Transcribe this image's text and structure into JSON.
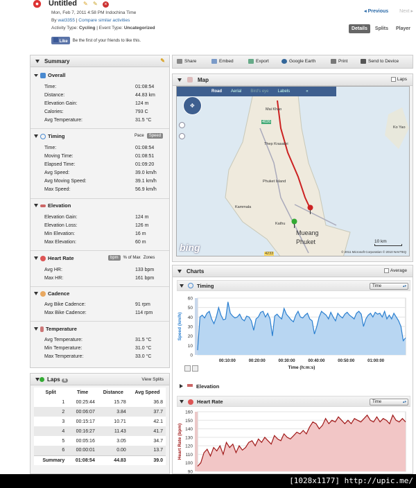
{
  "activity": {
    "title": "Untitled",
    "date_line": "Mon, Feb 7, 2011 4:58 PM Indochina Time",
    "by_prefix": "By",
    "user": "wat3355",
    "compare_link": "Compare similar activities",
    "type_label": "Activity Type:",
    "type_value": "Cycling",
    "event_label": "Event Type:",
    "event_value": "Uncategorized"
  },
  "nav": {
    "prev": "◂ Previous",
    "next": "Next ▸",
    "tabs": [
      "Details",
      "Splits",
      "Player"
    ]
  },
  "facebook": {
    "like": "Like",
    "text": "Be the first of your friends to like this."
  },
  "summary": {
    "title": "Summary",
    "overall": {
      "title": "Overall",
      "rows": [
        [
          "Time:",
          "01:08:54"
        ],
        [
          "Distance:",
          "44.83 km"
        ],
        [
          "Elevation Gain:",
          "124 m"
        ],
        [
          "Calories:",
          "793 C"
        ],
        [
          "Avg Temperature:",
          "31.5 °C"
        ]
      ]
    },
    "timing": {
      "title": "Timing",
      "toggle": [
        "Pace",
        "Speed"
      ],
      "rows": [
        [
          "Time:",
          "01:08:54"
        ],
        [
          "Moving Time:",
          "01:08:51"
        ],
        [
          "Elapsed Time:",
          "01:09:20"
        ],
        [
          "Avg Speed:",
          "39.0 km/h"
        ],
        [
          "Avg Moving Speed:",
          "39.1 km/h"
        ],
        [
          "Max Speed:",
          "56.9 km/h"
        ]
      ]
    },
    "elevation": {
      "title": "Elevation",
      "rows": [
        [
          "Elevation Gain:",
          "124 m"
        ],
        [
          "Elevation Loss:",
          "126 m"
        ],
        [
          "Min Elevation:",
          "16 m"
        ],
        [
          "Max Elevation:",
          "60 m"
        ]
      ]
    },
    "heart_rate": {
      "title": "Heart Rate",
      "toggle": [
        "bpm",
        "% of Max",
        "Zones"
      ],
      "rows": [
        [
          "Avg HR:",
          "133 bpm"
        ],
        [
          "Max HR:",
          "161 bpm"
        ]
      ]
    },
    "cadence": {
      "title": "Cadence",
      "rows": [
        [
          "Avg Bike Cadence:",
          "91 rpm"
        ],
        [
          "Max Bike Cadence:",
          "114 rpm"
        ]
      ]
    },
    "temperature": {
      "title": "Temperature",
      "rows": [
        [
          "Avg Temperature:",
          "31.5 °C"
        ],
        [
          "Min Temperature:",
          "31.0 °C"
        ],
        [
          "Max Temperature:",
          "33.0 °C"
        ]
      ]
    }
  },
  "laps": {
    "title": "Laps",
    "count": "6",
    "view": "View Splits",
    "headers": [
      "Split",
      "Time",
      "Distance",
      "Avg Speed"
    ],
    "rows": [
      [
        "1",
        "00:25:44",
        "15.78",
        "36.8"
      ],
      [
        "2",
        "00:06:07",
        "3.84",
        "37.7"
      ],
      [
        "3",
        "00:15:17",
        "10.71",
        "42.1"
      ],
      [
        "4",
        "00:16:27",
        "11.43",
        "41.7"
      ],
      [
        "5",
        "00:05:16",
        "3.05",
        "34.7"
      ],
      [
        "6",
        "00:00:01",
        "0.00",
        "13.7"
      ]
    ],
    "summary": [
      "Summary",
      "01:08:54",
      "44.83",
      "39.0"
    ]
  },
  "toolbar": [
    "Share",
    "Embed",
    "Export",
    "Google Earth",
    "Print",
    "Send to Device"
  ],
  "map": {
    "title": "Map",
    "laps": "Laps",
    "types": [
      "Road",
      "Aerial",
      "Bird's eye",
      "Labels"
    ],
    "places": [
      "Mai Khao",
      "4026",
      "Thep Krasattri",
      "Phuket Island",
      "Kammala",
      "Kathu",
      "Mueang",
      "Phuket",
      "Ko Yao"
    ],
    "scale": "10 km",
    "copyright": "© 2011 Microsoft Corporation  © 2010 NAVTEQ",
    "logo": "bing",
    "road_number": "4233"
  },
  "charts": {
    "title": "Charts",
    "average": "Average",
    "timing": {
      "title": "Timing",
      "select": "Time"
    },
    "elevation": {
      "title": "Elevation"
    },
    "heart_rate": {
      "title": "Heart Rate",
      "select": "Time"
    }
  },
  "chart_data": [
    {
      "type": "line",
      "ylabel": "Speed (km/h)",
      "xlabel": "Time (h:m:s)",
      "ylim": [
        0,
        60
      ],
      "yticks": [
        "60",
        "50",
        "40",
        "30",
        "20",
        "10",
        "0"
      ],
      "xticks": [
        "00:10:00",
        "00:20:00",
        "00:30:00",
        "00:40:00",
        "00:50:00",
        "01:00:00"
      ],
      "series": [
        {
          "values": [
            5,
            40,
            42,
            39,
            44,
            46,
            38,
            33,
            40,
            50,
            42,
            37,
            38,
            56,
            44,
            41,
            39,
            40,
            43,
            38,
            36,
            41,
            40,
            36,
            26,
            38,
            40,
            45,
            46,
            40,
            44,
            38,
            20,
            41,
            43,
            40,
            38,
            49,
            43,
            40,
            37,
            35,
            42,
            46,
            40,
            39,
            42,
            44,
            38,
            36,
            22,
            30,
            40,
            46,
            44,
            42,
            38,
            45,
            40,
            36,
            44,
            41,
            39,
            43,
            45,
            42,
            40,
            38,
            44,
            46,
            43,
            30,
            38,
            42,
            44,
            40,
            45,
            43,
            44,
            40,
            46,
            38,
            42,
            38,
            44,
            40,
            36,
            30,
            15,
            18
          ]
        }
      ]
    },
    {
      "type": "line",
      "ylabel": "Heart Rate (bpm)",
      "ylim": [
        90,
        160
      ],
      "yticks": [
        "160",
        "150",
        "140",
        "130",
        "120",
        "110",
        "100",
        "90"
      ],
      "series": [
        {
          "values": [
            96,
            100,
            112,
            116,
            108,
            118,
            114,
            120,
            110,
            124,
            118,
            122,
            112,
            120,
            115,
            118,
            124,
            126,
            120,
            128,
            124,
            130,
            126,
            122,
            132,
            128,
            126,
            134,
            130,
            128,
            132,
            136,
            134,
            138,
            134,
            142,
            148,
            146,
            140,
            144,
            152,
            146,
            150,
            148,
            154,
            150,
            146,
            150,
            146,
            152,
            150,
            148,
            152,
            156,
            150,
            148,
            154,
            148,
            152,
            150,
            146,
            156,
            150,
            148,
            152,
            148
          ]
        }
      ]
    }
  ]
}
